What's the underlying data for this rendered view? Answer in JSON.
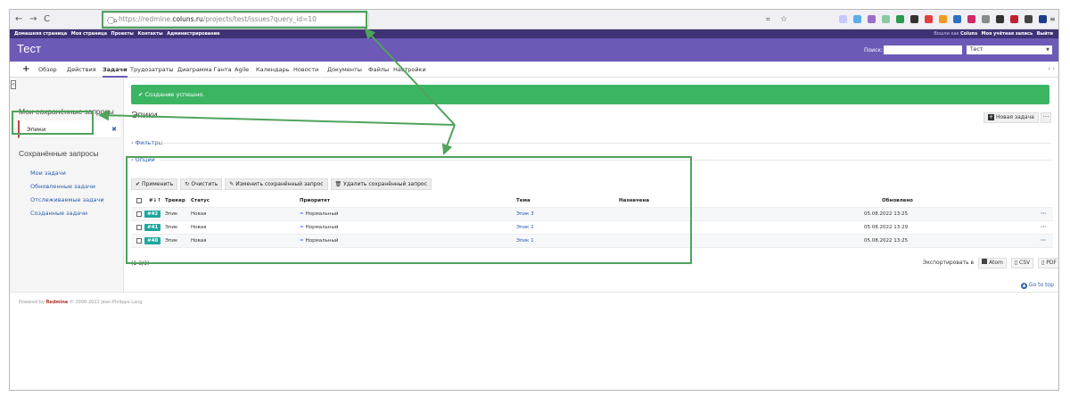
{
  "browser": {
    "back": "←",
    "forward": "→",
    "reload": "C",
    "url_prefix": "https://redmine.",
    "url_host": "coluns.ru",
    "url_path": "/projects/test/issues?query_id=10"
  },
  "topmenu": {
    "items": [
      "Домашняя страница",
      "Моя страница",
      "Проекты",
      "Контакты",
      "Администрирование"
    ],
    "logged_as_prefix": "Вошли как",
    "user": "Coluns",
    "my_account": "Моя учётная запись",
    "logout": "Выйти"
  },
  "header": {
    "title": "Тест",
    "search_label": "Поиск:",
    "project_select": "Тест"
  },
  "tabs": {
    "plus": "+",
    "items": [
      "Обзор",
      "Действия",
      "Задачи",
      "Трудозатраты",
      "Диаграмма Ганта",
      "Agile",
      "Календарь",
      "Новости",
      "Документы",
      "Файлы",
      "Настройки"
    ],
    "scroll": "‹ ›"
  },
  "sidebar": {
    "collapse": "<",
    "my_queries_title": "Мои сохранённые запросы",
    "my_queries": [
      {
        "label": "Эпики",
        "remove": "✖"
      }
    ],
    "saved_queries_title": "Сохранённые запросы",
    "links": [
      "Мои задачи",
      "Обновленные задачи",
      "Отслеживаемые задачи",
      "Созданные задачи"
    ]
  },
  "main": {
    "flash": "✔ Создание успешно.",
    "title": "Эпики",
    "new_issue": "Новая задача",
    "more": "···",
    "filters": "Фильтры",
    "options": "Опции",
    "buttons": [
      {
        "icon": "✔",
        "label": "Применить"
      },
      {
        "icon": "↻",
        "label": "Очистить"
      },
      {
        "icon": "✎",
        "label": "Изменить сохранённый запрос"
      },
      {
        "icon": "🗑",
        "label": "Удалить сохранённый запрос"
      }
    ],
    "columns": [
      "#",
      "Трекер",
      "Статус",
      "Приоритет",
      "Тема",
      "Назначена",
      "Обновлено"
    ],
    "rows": [
      {
        "id": "#42",
        "tracker": "Эпик",
        "status": "Новая",
        "priority": "Нормальный",
        "subject": "Эпик 3",
        "assignee": "",
        "updated": "05.08.2022 13:25"
      },
      {
        "id": "#41",
        "tracker": "Эпик",
        "status": "Новая",
        "priority": "Нормальный",
        "subject": "Эпик 2",
        "assignee": "",
        "updated": "05.08.2022 13:29"
      },
      {
        "id": "#40",
        "tracker": "Эпик",
        "status": "Новая",
        "priority": "Нормальный",
        "subject": "Эпик 1",
        "assignee": "",
        "updated": "05.08.2022 13:25"
      }
    ],
    "row_menu": "···",
    "count": "(1-3/3)",
    "export_label": "Экспортировать в",
    "export_formats": [
      "Atom",
      "CSV",
      "PDF"
    ],
    "go_to_top": "Go to top"
  },
  "footer": {
    "prefix": "Powered by ",
    "brand": "Redmine",
    "suffix": " © 2006-2022 Jean-Philippe Lang"
  },
  "annotation_color": "#4fa35c"
}
